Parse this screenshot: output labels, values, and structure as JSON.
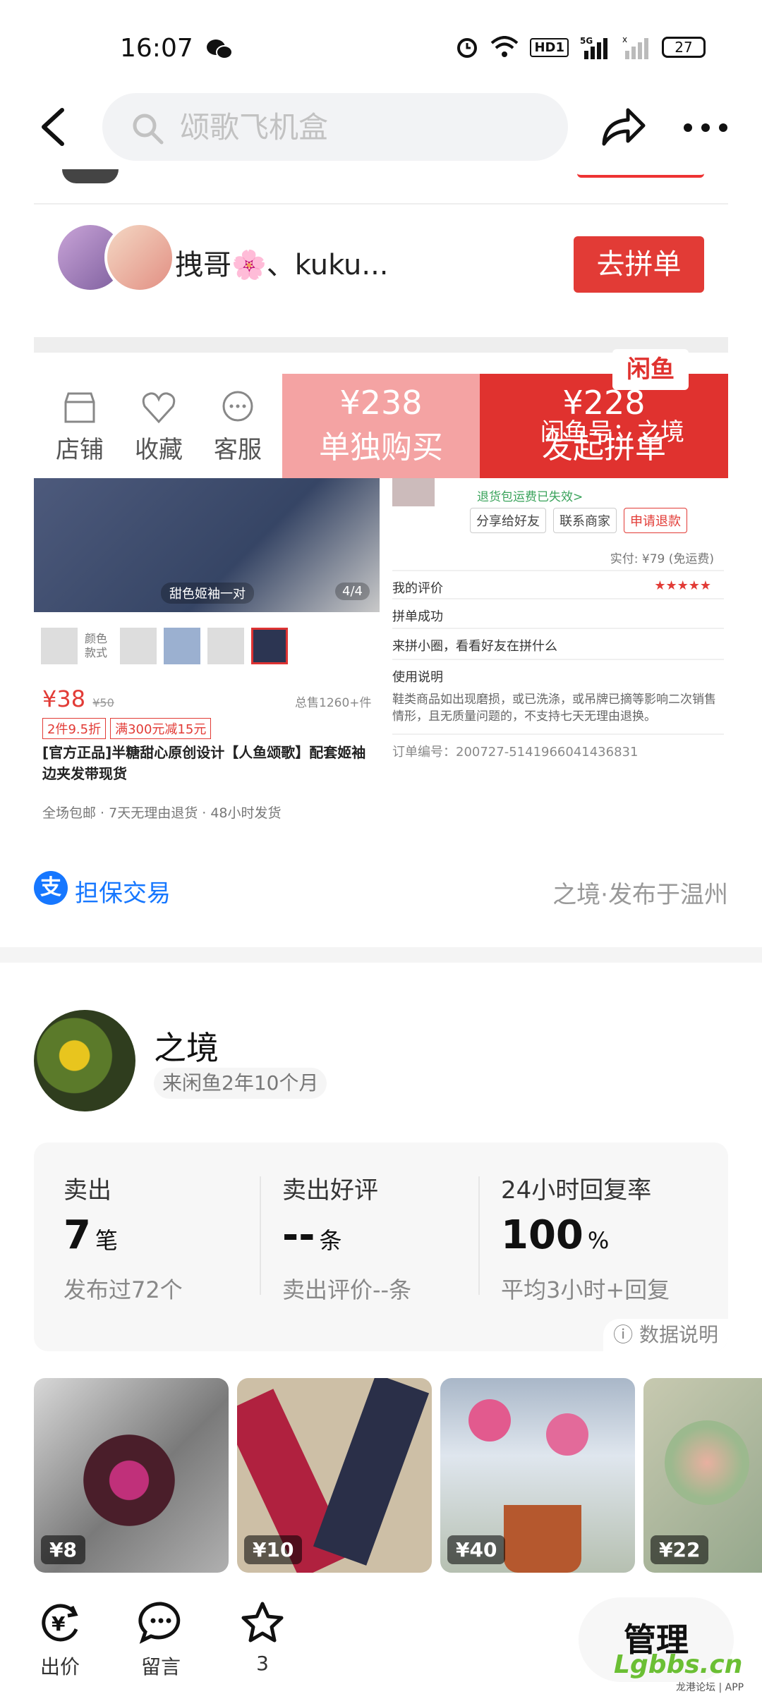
{
  "status_bar": {
    "time": "16:07",
    "network": "5G",
    "hd": "HD1",
    "battery": "27"
  },
  "top_bar": {
    "search_placeholder": "颂歌飞机盒"
  },
  "screenshot": {
    "group_users": "拽哥🌸、kuku...",
    "group_button": "去拼单",
    "bottom_bar": {
      "shop": "店铺",
      "favorite": "收藏",
      "service": "客服",
      "solo_price": "¥238",
      "solo_label": "单独购买",
      "group_price": "¥228",
      "group_label": "发起拼单"
    },
    "badge": "闲鱼",
    "watermark": "闲鱼号：之境",
    "image_tag": "甜色姬袖一对",
    "image_count": "4/4",
    "thumb_label": "颜色款式",
    "price": "¥38",
    "orig_price": "¥50",
    "sold": "总售1260+件",
    "tags": [
      "2件9.5折",
      "满300元减15元"
    ],
    "title": "[官方正品]半糖甜心原创设计【人鱼颂歌】配套姬袖边夹发带现货",
    "footer": "全场包邮 · 7天无理由退货 · 48小时发货",
    "return_note": "退货包运费已失效>",
    "action_buttons": [
      "分享给好友",
      "联系商家",
      "申请退款"
    ],
    "paid": "实付: ¥79 (免运费)",
    "my_review": "我的评价",
    "stars": "★★★★★",
    "group_success": "拼单成功",
    "circle": "来拼小圈，看看好友在拼什么",
    "usage_title": "使用说明",
    "usage_text": "鞋类商品如出现磨损，或已洗涤，或吊牌已摘等影响二次销售情形，且无质量问题的，不支持七天无理由退换。",
    "order_no": "订单编号：200727-5141966041436831"
  },
  "trade": {
    "guarantee": "担保交易",
    "published": "之境·发布于温州"
  },
  "seller": {
    "name": "之境",
    "joined": "来闲鱼2年10个月"
  },
  "stats": [
    {
      "label": "卖出",
      "value": "7",
      "unit": "笔",
      "sub": "发布过72个"
    },
    {
      "label": "卖出好评",
      "value": "--",
      "unit": "条",
      "sub": "卖出评价--条"
    },
    {
      "label": "24小时回复率",
      "value": "100",
      "unit": "%",
      "sub": "平均3小时+回复"
    }
  ],
  "data_info": "数据说明",
  "items": [
    {
      "price": "¥8"
    },
    {
      "price": "¥10"
    },
    {
      "price": "¥40"
    },
    {
      "price": "¥22"
    }
  ],
  "actions": {
    "offer": "出价",
    "comment": "留言",
    "fav_count": "3",
    "manage": "管理"
  },
  "watermark_site": "Lgbbs.cn",
  "watermark_sub": "龙港论坛 | APP",
  "colors": {
    "accent_red": "#e0322f",
    "alipay_blue": "#1677ff"
  }
}
